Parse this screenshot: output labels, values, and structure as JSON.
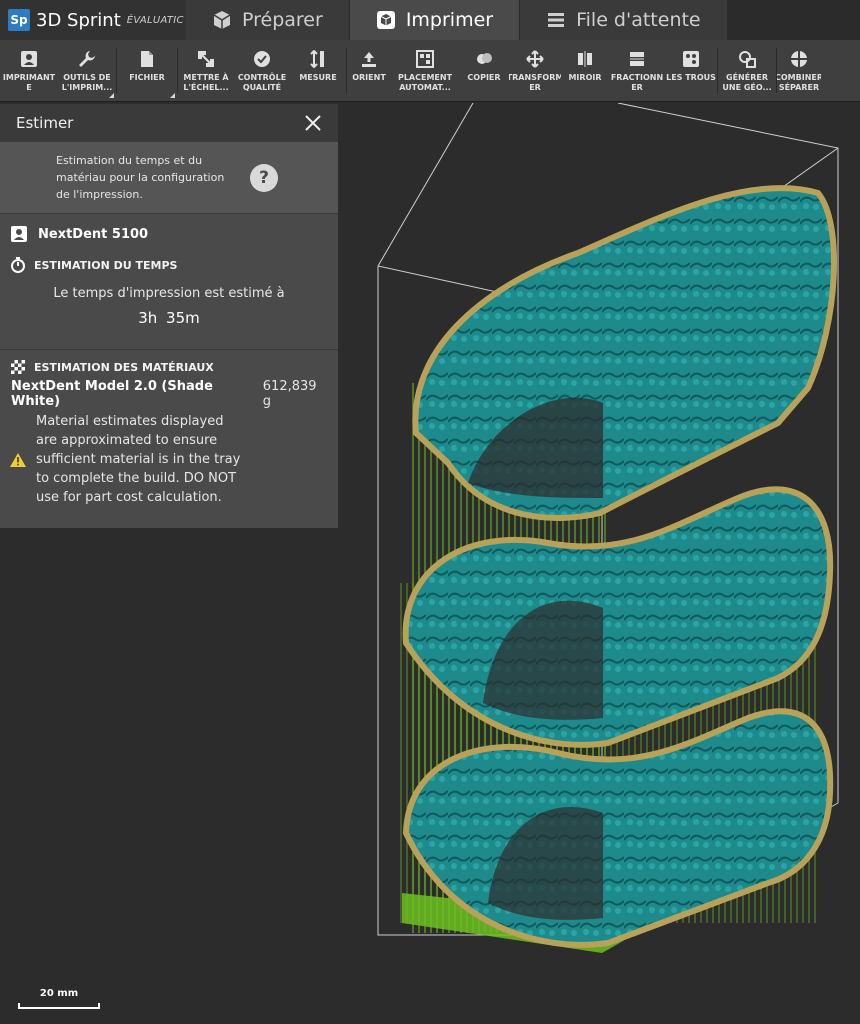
{
  "app": {
    "logo": "Sp",
    "name": "3D Sprint",
    "edition": "ÉVALUATIC"
  },
  "tabs": [
    {
      "label": "Préparer",
      "icon": "cube-icon",
      "active": false
    },
    {
      "label": "Imprimer",
      "icon": "cube-outline-icon",
      "active": true
    },
    {
      "label": "File d'attente",
      "icon": "list-icon",
      "active": false
    }
  ],
  "toolbar": {
    "imprimante": "IMPRIMANT\nE",
    "outils": "OUTILS DE\nL'IMPRIM...",
    "fichier": "FICHIER",
    "mettre": "METTRE À\nL'ÉCHEL...",
    "controle": "CONTRÔLE\nQUALITÉ",
    "mesure": "MESURE",
    "orient": "ORIENT",
    "placement": "PLACEMENT\nAUTOMAT...",
    "copier": "COPIER",
    "transformer": "TRANSFORM\nER",
    "miroir": "MIROIR",
    "fractionner": "FRACTIONN\nER",
    "trous": "LES TROUS",
    "generer": "GÉNÉRER\nUNE GÉO...",
    "combiner": "COMBINER\nSÉPARER"
  },
  "panel": {
    "title": "Estimer",
    "intro": "Estimation du temps et du matériau pour la configuration de l'impression.",
    "help": "?",
    "printer": "NextDent 5100",
    "time_section": "ESTIMATION DU TEMPS",
    "time_label": "Le temps d'impression est estimé à",
    "time_value": "3h 35m",
    "materials_section": "ESTIMATION DES MATÉRIAUX",
    "material_name": "NextDent Model 2.0 (Shade White)",
    "material_amount": "612,839 g",
    "warning": "Material estimates displayed are approximated to ensure sufficient material is in the tray to complete the build. DO NOT use for part cost calculation."
  },
  "viewport": {
    "scale_label": "20 mm",
    "colors": {
      "model": "#1f8a8c",
      "support": "#6fc021",
      "outline": "#b8a25a",
      "box": "#d0d0d0"
    }
  }
}
